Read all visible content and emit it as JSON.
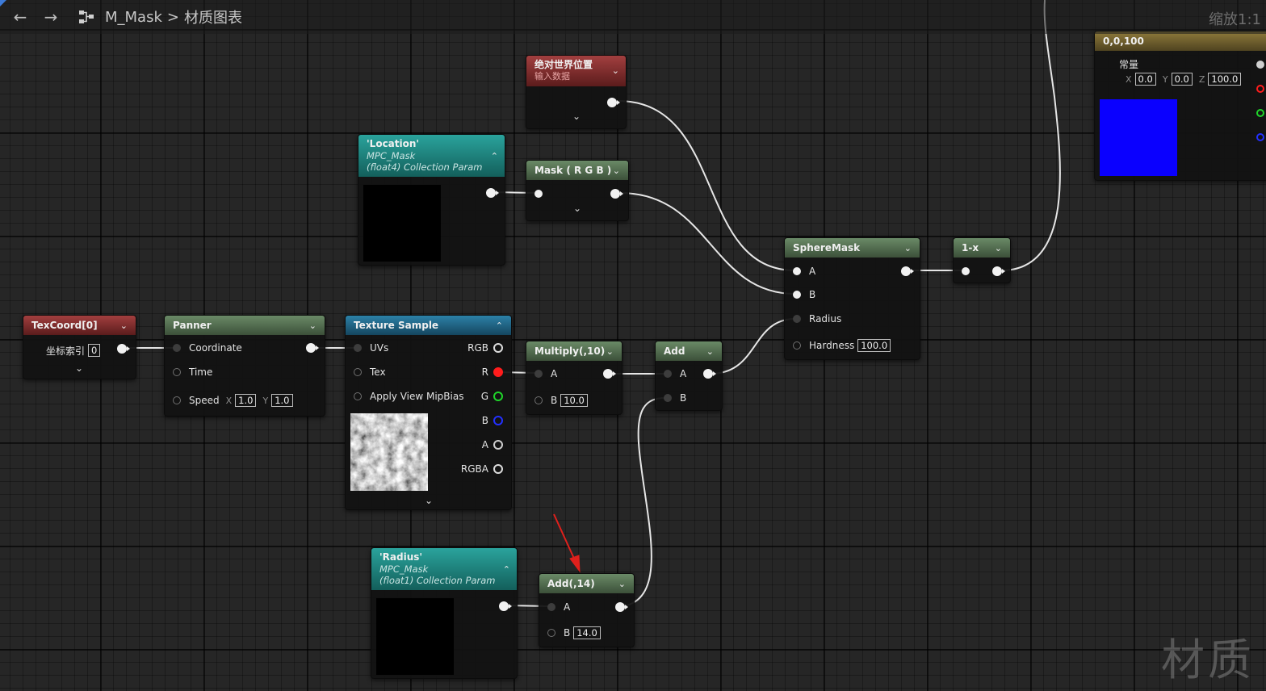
{
  "toolbar": {
    "back_icon": "arrow-left-icon",
    "forward_icon": "arrow-right-icon",
    "graph_icon": "graph-icon",
    "asset": "M_Mask",
    "separator": ">",
    "graph_name": "材质图表",
    "zoom": "缩放1:1"
  },
  "watermark": "材质",
  "nodes": {
    "world_pos": {
      "title": "绝对世界位置",
      "subtitle": "输入数据"
    },
    "location": {
      "title": "'Location'",
      "sub1": "MPC_Mask",
      "sub2": "(float4) Collection Param"
    },
    "mask_rgb": {
      "title": "Mask ( R G B )"
    },
    "sphere_mask": {
      "title": "SphereMask",
      "pin_a": "A",
      "pin_b": "B",
      "pin_radius": "Radius",
      "pin_hardness": "Hardness",
      "hardness_value": "100.0"
    },
    "one_minus": {
      "title": "1-x"
    },
    "constant3": {
      "title": "0,0,100",
      "label": "常量",
      "x_label": "X",
      "x_value": "0.0",
      "y_label": "Y",
      "y_value": "0.0",
      "z_label": "Z",
      "z_value": "100.0",
      "swatch_color": "#0a00ff"
    },
    "texcoord": {
      "title": "TexCoord[0]",
      "index_label": "坐标索引",
      "index_value": "0"
    },
    "panner": {
      "title": "Panner",
      "pin_coordinate": "Coordinate",
      "pin_time": "Time",
      "pin_speed": "Speed",
      "x_label": "X",
      "x_value": "1.0",
      "y_label": "Y",
      "y_value": "1.0"
    },
    "texture_sample": {
      "title": "Texture Sample",
      "pin_uvs": "UVs",
      "pin_tex": "Tex",
      "pin_mip": "Apply View MipBias",
      "out_rgb": "RGB",
      "out_r": "R",
      "out_g": "G",
      "out_b": "B",
      "out_a": "A",
      "out_rgba": "RGBA"
    },
    "multiply": {
      "title": "Multiply(,10)",
      "pin_a": "A",
      "pin_b": "B",
      "b_value": "10.0"
    },
    "add": {
      "title": "Add",
      "pin_a": "A",
      "pin_b": "B"
    },
    "radius": {
      "title": "'Radius'",
      "sub1": "MPC_Mask",
      "sub2": "(float1) Collection Param"
    },
    "add14": {
      "title": "Add(,14)",
      "pin_a": "A",
      "pin_b": "B",
      "b_value": "14.0"
    }
  },
  "colors": {
    "pin_r": "#ff1c1c",
    "pin_g": "#1fd42a",
    "pin_b": "#2330ff",
    "annotation_arrow": "#e0201c"
  }
}
